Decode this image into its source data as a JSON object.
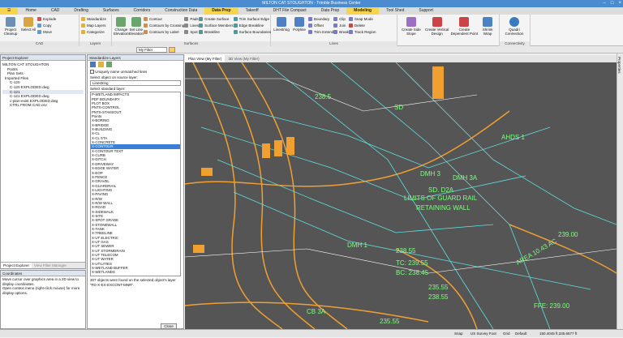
{
  "app": {
    "title": "MILTON CAT STOUGHTON - Trimble Business Center"
  },
  "ribbon_tabs": [
    "Home",
    "CAD",
    "Drafting",
    "Surfaces",
    "Corridors",
    "Construction Data",
    "Data Prep",
    "Takeoff",
    "DHT File Compact",
    "Data Prep",
    "Modeling",
    "Tool Shed",
    "Support"
  ],
  "ribbon": {
    "cad": {
      "label": "CAD",
      "project_label": "Project Cleanup",
      "select_label": "Select All",
      "explode": "Explode",
      "copy": "Copy",
      "move": "Move"
    },
    "layers": {
      "label": "Layers",
      "standardize": "Standardize",
      "map_layers": "Map Layers",
      "categorize": "Categorize"
    },
    "elevation": {
      "change_label": "Change Elevation",
      "set_line_label": "Set Line Elevation"
    },
    "contour": {
      "contour": "Contour",
      "by_crossing": "Contours by Crossing",
      "by_label": "Contours by Label"
    },
    "pads": {
      "pads": "Pads",
      "lines": "Lines",
      "spot": "Spot",
      "label": "Surfaces"
    },
    "surface": {
      "create_surface": "Create Surface",
      "surface_members": "Surface Members",
      "breakline": "Breakline",
      "trim_edge": "Trim Surface Edge",
      "edge_breakline": "Edge Breakline",
      "surface_boundaries": "Surface Boundaries"
    },
    "linework": {
      "linestring": "Linestring",
      "polyline": "Polyline",
      "boundary": "Boundary",
      "offset": "Offset",
      "trim_extend": "Trim Extend",
      "clip": "Clip",
      "join": "Join",
      "break": "Break",
      "snap_mode": "Snap Mode",
      "delete": "Delete",
      "track_region": "Track Region",
      "label": "Lines"
    },
    "side": {
      "side_slope": "Create Side Slope",
      "vertical_design": "Create Vertical Design",
      "dependent_point": "Create Dependent Point",
      "shrink_wrap": "Shrink Wrap"
    },
    "quadri": {
      "connect": "Quadri Connection",
      "label": "Connectivity"
    }
  },
  "toolbar2": {
    "filter": "My Filter"
  },
  "project_explorer": {
    "title": "Project Explorer",
    "items": [
      "MILTON CAT STOUGHTON",
      "Points",
      "Plan Sets",
      "Imported Files",
      "C-120",
      "C-120 EXPLODED.dwg",
      "C-121",
      "C-121 EXPLODED.dwg",
      "c-plan-exist EXPLODED.dwg",
      "CTRL FROM CAD.csv"
    ],
    "bottom_tabs": [
      "Project Explorer",
      "View Filter Manager"
    ]
  },
  "coordinates": {
    "title": "Coordinates",
    "text": [
      "Move cursor over graphics area in a 2D view to display coordinates.",
      "Open context menu (right-click mouse) for more display options."
    ]
  },
  "standardize": {
    "title": "Standardize Layers",
    "checkbox_label": "Uniquely name unmatched lines",
    "source_label": "Select object on source layer:",
    "source_value": "Linestring",
    "standard_label": "Select standard layer:",
    "layers": [
      "P-WETLAND IMPACTS",
      "PDF BOUNDARY",
      "PLOT BOX",
      "PNTS-CONTROL",
      "PNTS-STAKEOUT",
      "Points",
      "X-BORING",
      "X-BRIDGE",
      "X-BUILDING",
      "X-CL",
      "X-CL STA",
      "X-CONCRETE",
      "X-CONTOUR",
      "X-CONTOUR TEXT",
      "X-CURB",
      "X-DITCH",
      "X-DRIVEWAY",
      "X-EDGE WATER",
      "X-EOP",
      "X-FENCE",
      "X-GRAVEL",
      "X-GUARDRAIL",
      "X-LIGHTING",
      "X-PAVING",
      "X-R/W",
      "X-R/W WALL",
      "X-ROAD",
      "X-SIDEWALK",
      "X-SITE",
      "X-SPOT GRADE",
      "X-STONEWALL",
      "X-TANK",
      "X-TREELINE",
      "X-UT ELECTRIC",
      "X-UT GAS",
      "X-UT SEWER",
      "X-UT STORMDRAIN",
      "X-UT TELECOM",
      "X-UT WATER",
      "X-UTILITIES",
      "X-WETLAND BUFFER",
      "X-WETLANDS"
    ],
    "selected_index": 12,
    "footer": "307 objects were found on the selected object's layer \"FD-X-EX-EXCONT-MNR\".",
    "close": "Close"
  },
  "doc_tabs": [
    "Plan View (My Filter)",
    "3D View (My Filter)"
  ],
  "canvas_labels": [
    "238.5",
    "SD",
    "AHDS 1",
    "DMH 3",
    "DMH 3A",
    "SD. D2A",
    "LIMITS OF GUARD RAIL",
    "RETAINING WALL",
    "DMH 1",
    "AREA 10.43 AC",
    "238.55",
    "TC: 239.55",
    "BC: 238.45",
    "235.55",
    "238.55",
    "CB 3A",
    "FFE: 239.00",
    "239.00",
    "235.55"
  ],
  "status": {
    "units": "US Survey Foot",
    "grid": "Grid",
    "default": "Default",
    "coords": "150.4045 ft,335.6577 ft",
    "snap": "Snap"
  },
  "right_strip": "Properties"
}
